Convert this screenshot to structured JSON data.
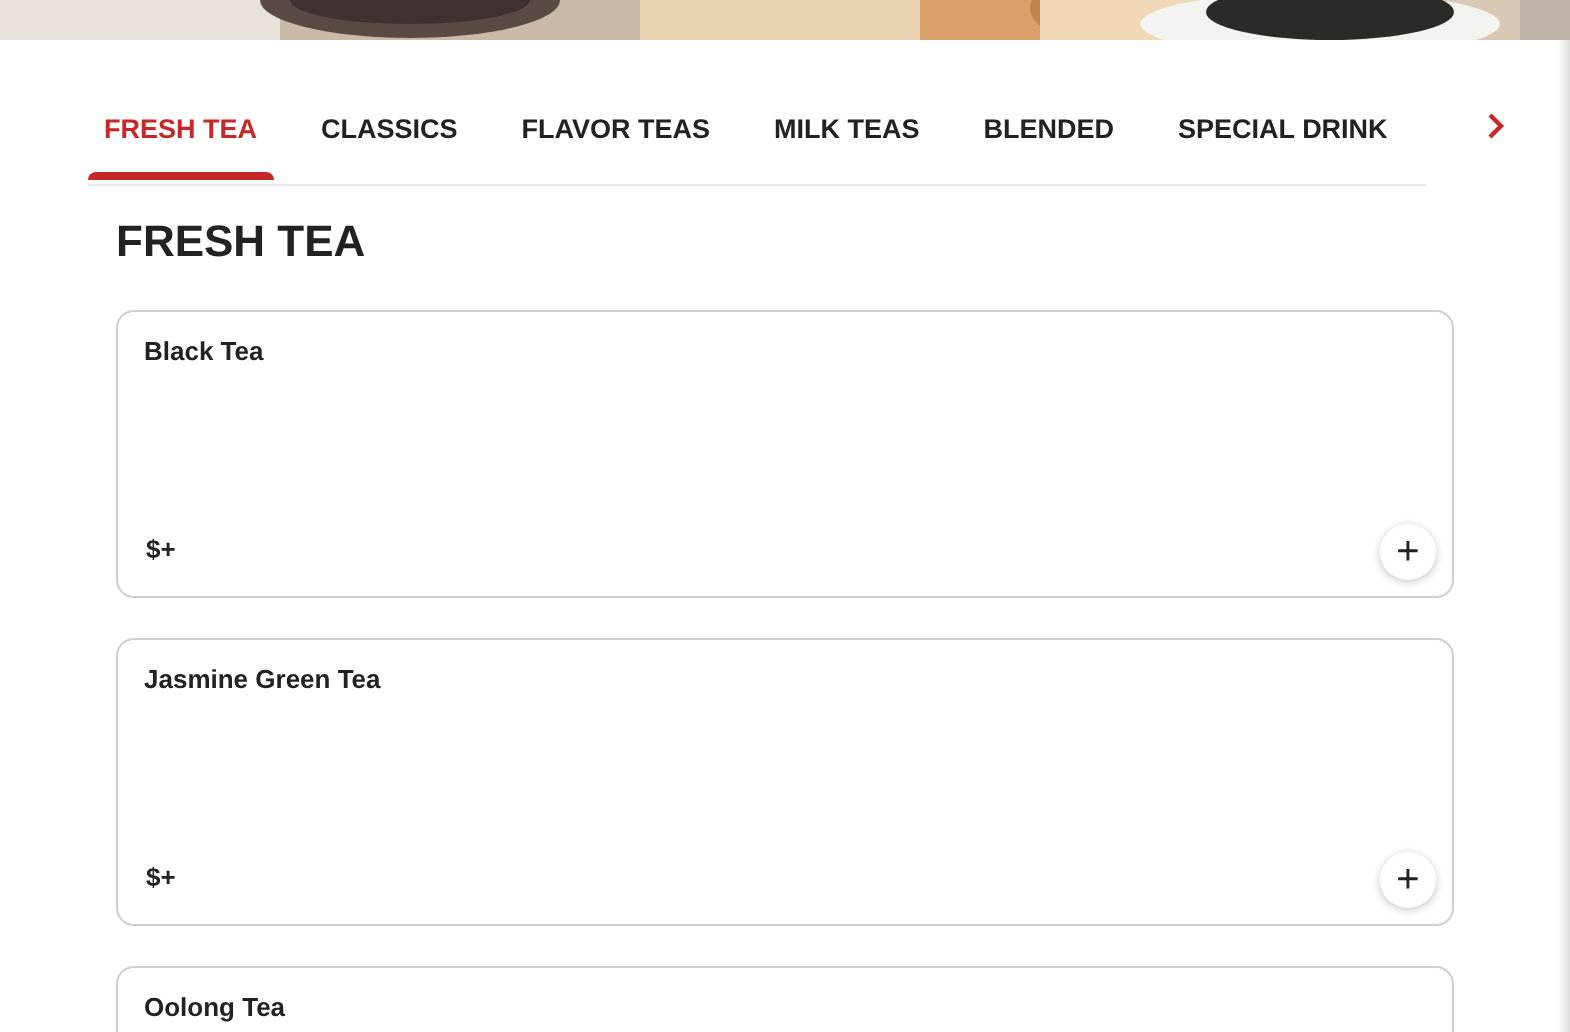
{
  "tabs": [
    {
      "label": "FRESH TEA",
      "selected": true
    },
    {
      "label": "CLASSICS",
      "selected": false
    },
    {
      "label": "FLAVOR TEAS",
      "selected": false
    },
    {
      "label": "MILK TEAS",
      "selected": false
    },
    {
      "label": "BLENDED",
      "selected": false
    },
    {
      "label": "SPECIAL DRINK",
      "selected": false
    }
  ],
  "section_title": "FRESH TEA",
  "items": [
    {
      "name": "Black Tea",
      "price": "$+",
      "add_button": "+"
    },
    {
      "name": "Jasmine Green Tea",
      "price": "$+",
      "add_button": "+"
    },
    {
      "name": "Oolong Tea"
    }
  ]
}
